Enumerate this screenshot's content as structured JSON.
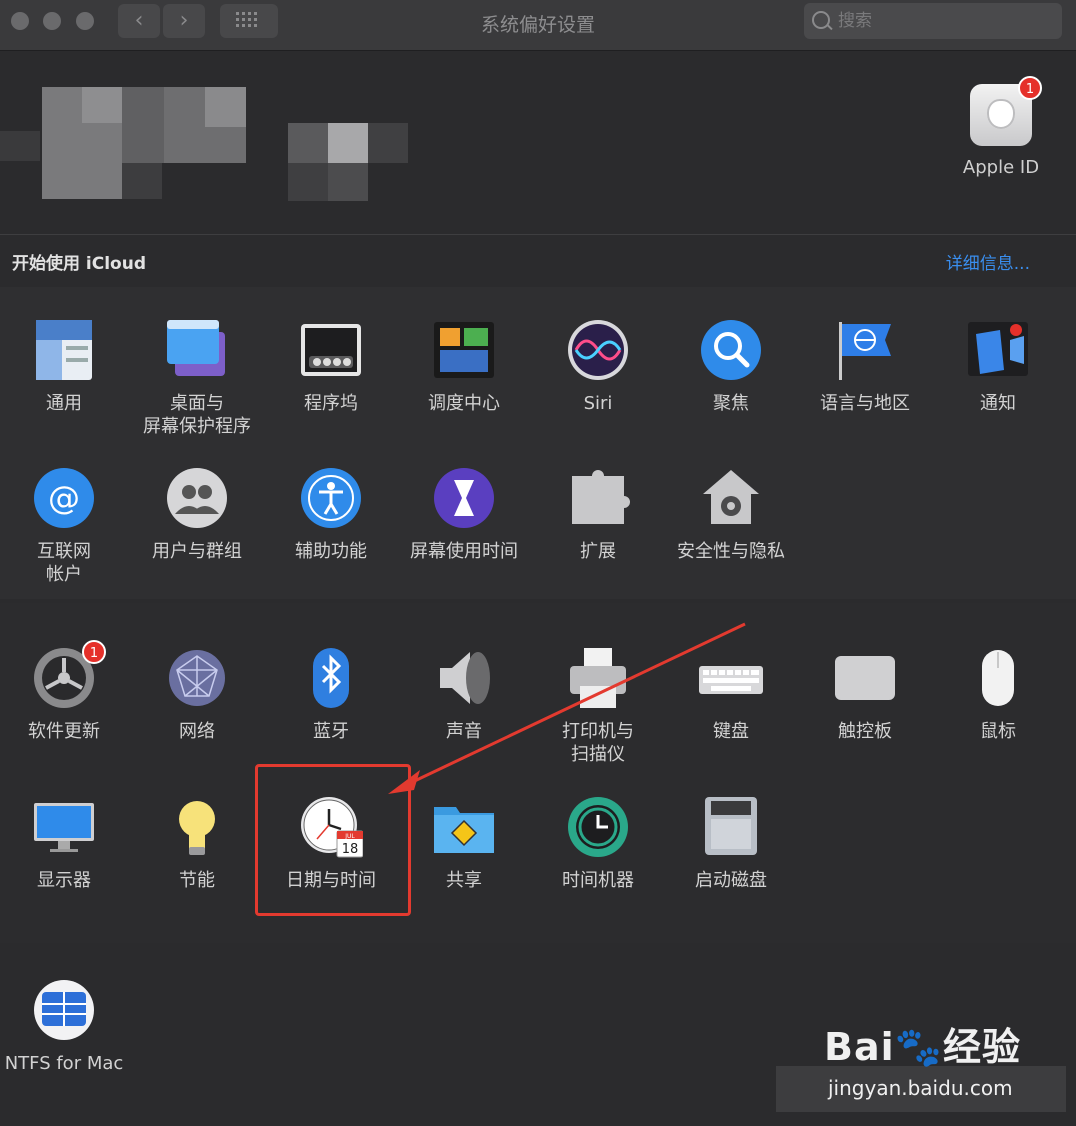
{
  "window": {
    "title": "系统偏好设置"
  },
  "search": {
    "placeholder": "搜索"
  },
  "apple_id": {
    "label": "Apple ID",
    "badge": "1"
  },
  "icloud": {
    "label": "开始使用 iCloud",
    "link": "详细信息..."
  },
  "colors": {
    "accent_link": "#3a8ff0",
    "badge_red": "#e5302a",
    "highlight_red": "#e33a2f"
  },
  "sections": [
    {
      "panes": [
        {
          "id": "general",
          "label": "通用",
          "icon": "general-icon"
        },
        {
          "id": "desktop",
          "label": "桌面与\n屏幕保护程序",
          "icon": "desktop-screensaver-icon"
        },
        {
          "id": "dock",
          "label": "程序坞",
          "icon": "dock-icon"
        },
        {
          "id": "mission-control",
          "label": "调度中心",
          "icon": "mission-control-icon"
        },
        {
          "id": "siri",
          "label": "Siri",
          "icon": "siri-icon"
        },
        {
          "id": "spotlight",
          "label": "聚焦",
          "icon": "spotlight-icon"
        },
        {
          "id": "language",
          "label": "语言与地区",
          "icon": "language-region-icon"
        },
        {
          "id": "notifications",
          "label": "通知",
          "icon": "notifications-icon"
        },
        {
          "id": "internet-accounts",
          "label": "互联网\n帐户",
          "icon": "internet-accounts-icon"
        },
        {
          "id": "users",
          "label": "用户与群组",
          "icon": "users-groups-icon"
        },
        {
          "id": "accessibility",
          "label": "辅助功能",
          "icon": "accessibility-icon"
        },
        {
          "id": "screen-time",
          "label": "屏幕使用时间",
          "icon": "screen-time-icon"
        },
        {
          "id": "extensions",
          "label": "扩展",
          "icon": "extensions-icon"
        },
        {
          "id": "security",
          "label": "安全性与隐私",
          "icon": "security-privacy-icon"
        }
      ]
    },
    {
      "panes": [
        {
          "id": "software-update",
          "label": "软件更新",
          "icon": "software-update-icon",
          "badge": "1"
        },
        {
          "id": "network",
          "label": "网络",
          "icon": "network-icon"
        },
        {
          "id": "bluetooth",
          "label": "蓝牙",
          "icon": "bluetooth-icon"
        },
        {
          "id": "sound",
          "label": "声音",
          "icon": "sound-icon"
        },
        {
          "id": "printers",
          "label": "打印机与\n扫描仪",
          "icon": "printer-scanner-icon"
        },
        {
          "id": "keyboard",
          "label": "键盘",
          "icon": "keyboard-icon"
        },
        {
          "id": "trackpad",
          "label": "触控板",
          "icon": "trackpad-icon"
        },
        {
          "id": "mouse",
          "label": "鼠标",
          "icon": "mouse-icon"
        },
        {
          "id": "displays",
          "label": "显示器",
          "icon": "display-icon"
        },
        {
          "id": "energy",
          "label": "节能",
          "icon": "energy-saver-icon"
        },
        {
          "id": "date-time",
          "label": "日期与时间",
          "icon": "date-time-icon",
          "highlighted": true
        },
        {
          "id": "sharing",
          "label": "共享",
          "icon": "sharing-icon"
        },
        {
          "id": "time-machine",
          "label": "时间机器",
          "icon": "time-machine-icon"
        },
        {
          "id": "startup-disk",
          "label": "启动磁盘",
          "icon": "startup-disk-icon"
        }
      ]
    },
    {
      "panes": [
        {
          "id": "ntfs",
          "label": "NTFS for Mac",
          "icon": "ntfs-icon"
        }
      ]
    }
  ],
  "date_time_icon": {
    "month": "JUL",
    "day": "18"
  },
  "watermark": {
    "brand": "Bai🐾经验",
    "site": "jingyan.baidu.com"
  }
}
